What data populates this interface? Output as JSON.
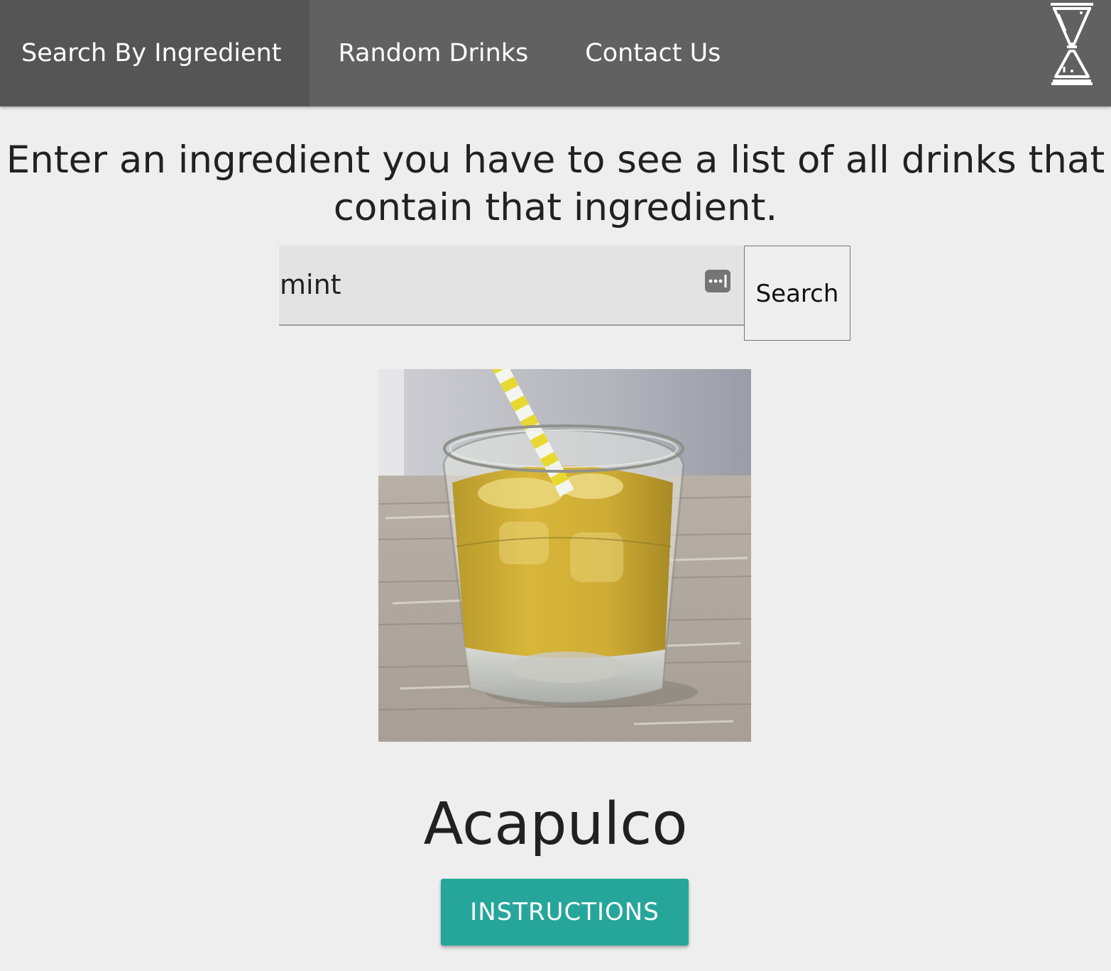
{
  "nav": {
    "items": [
      {
        "label": "Search By Ingredient",
        "active": true
      },
      {
        "label": "Random Drinks",
        "active": false
      },
      {
        "label": "Contact Us",
        "active": false
      }
    ],
    "logo_icon": "cocktail-jigger-icon"
  },
  "main": {
    "headline_line1": "Enter an ingredient you have to see a list of all drinks that",
    "headline_line2": "contain that ingredient.",
    "search": {
      "value": "mint",
      "button_label": "Search",
      "autofill_icon": "password-manager-icon"
    }
  },
  "result": {
    "drink_name": "Acapulco",
    "image_alt": "Acapulco drink photo",
    "button_label": "INSTRUCTIONS"
  },
  "colors": {
    "navbar": "#616161",
    "navbar_active": "#555555",
    "page_background": "#eeeeee",
    "accent_button": "#26a69a"
  }
}
